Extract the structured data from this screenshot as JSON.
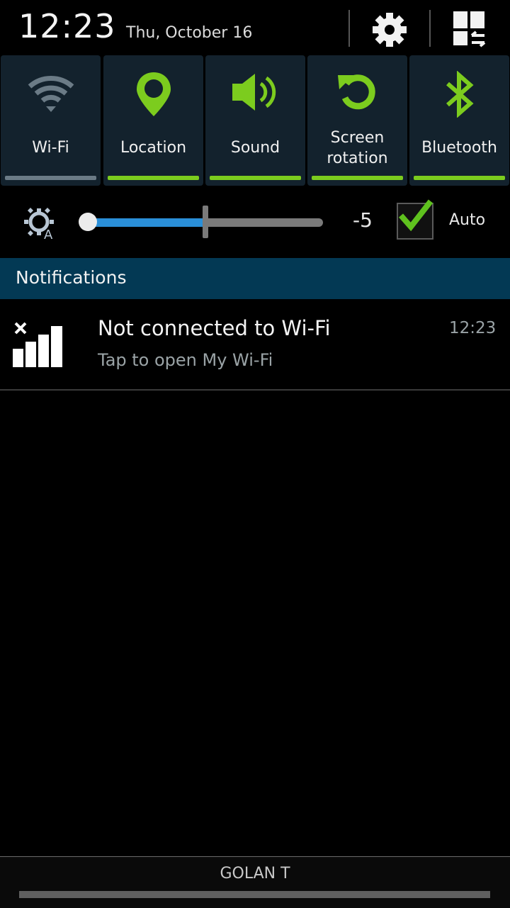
{
  "header": {
    "time": "12:23",
    "date": "Thu, October 16",
    "settings_icon": "gear-icon",
    "edit_icon": "quick-settings-grid-icon"
  },
  "toggles": [
    {
      "label": "Wi-Fi",
      "icon": "wifi-icon",
      "state": "off"
    },
    {
      "label": "Location",
      "icon": "location-pin-icon",
      "state": "on"
    },
    {
      "label": "Sound",
      "icon": "speaker-icon",
      "state": "on"
    },
    {
      "label_line1": "Screen",
      "label_line2": "rotation",
      "icon": "rotate-icon",
      "state": "on"
    },
    {
      "label": "Bluetooth",
      "icon": "bluetooth-icon",
      "state": "on"
    }
  ],
  "colors": {
    "on": "#7ccc1e",
    "off": "#6b7b86",
    "tile_bg": "#13222d",
    "header_bg": "#033954",
    "slider_fill": "#2a8fd8"
  },
  "brightness": {
    "icon": "auto-brightness-icon",
    "value": "-5",
    "level_fraction": 0.0,
    "auto_label": "Auto",
    "auto_checked": true
  },
  "notifications": {
    "header": "Notifications",
    "items": [
      {
        "icon": "wifi-signal-disconnected-icon",
        "title": "Not connected to Wi-Fi",
        "subtitle": "Tap to open My Wi-Fi",
        "time": "12:23"
      }
    ]
  },
  "footer": {
    "carrier": "GOLAN T"
  }
}
